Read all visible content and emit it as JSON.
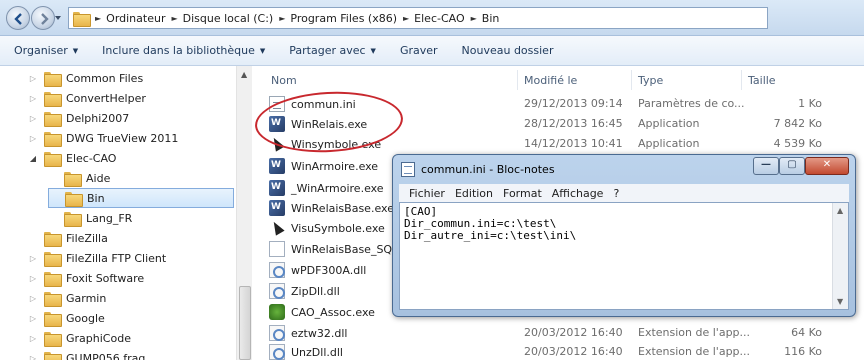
{
  "breadcrumb": {
    "segments": [
      "Ordinateur",
      "Disque local (C:)",
      "Program Files (x86)",
      "Elec-CAO",
      "Bin"
    ]
  },
  "toolbar": {
    "organize": "Organiser",
    "include_library": "Inclure dans la bibliothèque",
    "share_with": "Partager avec",
    "burn": "Graver",
    "new_folder": "Nouveau dossier"
  },
  "tree": [
    {
      "label": "Common Files"
    },
    {
      "label": "ConvertHelper"
    },
    {
      "label": "Delphi2007"
    },
    {
      "label": "DWG TrueView 2011"
    },
    {
      "label": "Elec-CAO"
    },
    {
      "label": "Aide"
    },
    {
      "label": "Bin"
    },
    {
      "label": "Lang_FR"
    },
    {
      "label": "FileZilla"
    },
    {
      "label": "FileZilla FTP Client"
    },
    {
      "label": "Foxit Software"
    },
    {
      "label": "Garmin"
    },
    {
      "label": "Google"
    },
    {
      "label": "GraphiCode"
    },
    {
      "label": "GUMP056 frag"
    }
  ],
  "columns": {
    "name": "Nom",
    "modified": "Modifié le",
    "type": "Type",
    "size": "Taille"
  },
  "files": [
    {
      "name": "commun.ini",
      "date": "29/12/2013 09:14",
      "type": "Paramètres de co...",
      "size": "1 Ko",
      "icon": "ini-file-icon"
    },
    {
      "name": "WinRelais.exe",
      "date": "28/12/2013 16:45",
      "type": "Application",
      "size": "7 842 Ko",
      "icon": "exe-icon"
    },
    {
      "name": "Winsymbole.exe",
      "date": "14/12/2013 10:41",
      "type": "Application",
      "size": "4 539 Ko",
      "icon": "exe-icon"
    },
    {
      "name": "WinArmoire.exe",
      "date": "",
      "type": "",
      "size": "",
      "icon": "exe-icon"
    },
    {
      "name": "_WinArmoire.exe",
      "date": "",
      "type": "",
      "size": "",
      "icon": "exe-icon"
    },
    {
      "name": "WinRelaisBase.exe",
      "date": "",
      "type": "",
      "size": "",
      "icon": "exe-icon"
    },
    {
      "name": "VisuSymbole.exe",
      "date": "",
      "type": "",
      "size": "",
      "icon": "exe-icon"
    },
    {
      "name": "WinRelaisBase_SQL",
      "date": "",
      "type": "",
      "size": "",
      "icon": "file-icon"
    },
    {
      "name": "wPDF300A.dll",
      "date": "",
      "type": "",
      "size": "",
      "icon": "dll-icon"
    },
    {
      "name": "ZipDll.dll",
      "date": "",
      "type": "",
      "size": "",
      "icon": "dll-icon"
    },
    {
      "name": "CAO_Assoc.exe",
      "date": "",
      "type": "",
      "size": "",
      "icon": "exe-icon"
    },
    {
      "name": "eztw32.dll",
      "date": "20/03/2012 16:40",
      "type": "Extension de l'app...",
      "size": "64 Ko",
      "icon": "dll-icon"
    },
    {
      "name": "UnzDll.dll",
      "date": "20/03/2012 16:40",
      "type": "Extension de l'app...",
      "size": "116 Ko",
      "icon": "dll-icon"
    }
  ],
  "notepad": {
    "title": "commun.ini - Bloc-notes",
    "menu": [
      "Fichier",
      "Edition",
      "Format",
      "Affichage",
      "?"
    ],
    "content": "[CAO]\nDir_commun.ini=c:\\test\\\nDir_autre_ini=c:\\test\\ini\\"
  }
}
